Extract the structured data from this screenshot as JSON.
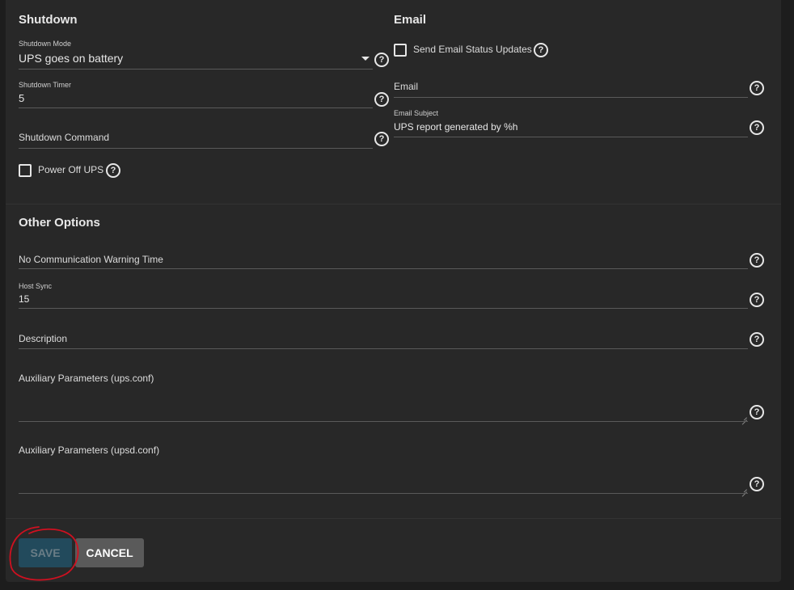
{
  "shutdown": {
    "title": "Shutdown",
    "mode_label": "Shutdown Mode",
    "mode_value": "UPS goes on battery",
    "timer_label": "Shutdown Timer",
    "timer_value": "5",
    "command_placeholder": "Shutdown Command",
    "power_off_label": "Power Off UPS",
    "power_off_checked": false
  },
  "email": {
    "title": "Email",
    "send_updates_label": "Send Email Status Updates",
    "send_updates_checked": false,
    "email_placeholder": "Email",
    "subject_label": "Email Subject",
    "subject_value": "UPS report generated by %h"
  },
  "other": {
    "title": "Other Options",
    "no_comm_placeholder": "No Communication Warning Time",
    "host_sync_label": "Host Sync",
    "host_sync_value": "15",
    "description_placeholder": "Description",
    "aux_ups_placeholder": "Auxiliary Parameters (ups.conf)",
    "aux_upsd_placeholder": "Auxiliary Parameters (upsd.conf)"
  },
  "actions": {
    "save_label": "SAVE",
    "cancel_label": "CANCEL"
  },
  "help_glyph": "?",
  "colors": {
    "background": "#1d1d1d",
    "card": "#282828",
    "save_button": "#224a5c",
    "save_text": "#6a7d86",
    "cancel_button": "#5a5a5a",
    "annotation": "#d01020"
  }
}
